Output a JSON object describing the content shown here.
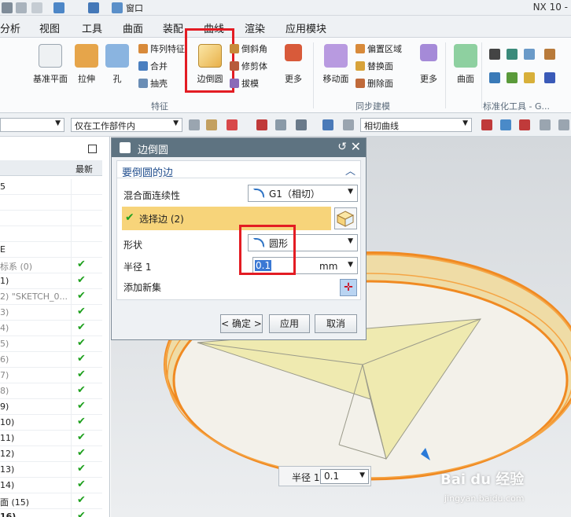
{
  "titlebar": {
    "window_menu": "窗口",
    "app_title": "NX 10 -"
  },
  "menu": {
    "items": [
      "分析",
      "视图",
      "工具",
      "曲面",
      "装配",
      "曲线",
      "渲染",
      "应用模块"
    ]
  },
  "ribbon": {
    "big": [
      {
        "label": "基准平面"
      },
      {
        "label": "拉伸"
      },
      {
        "label": "孔"
      },
      {
        "label": "边倒圆"
      },
      {
        "label": "更多"
      },
      {
        "label": "移动面"
      },
      {
        "label": "更多"
      },
      {
        "label": "曲面"
      }
    ],
    "small": {
      "pattern": "阵列特征",
      "unite": "合并",
      "shell": "抽壳",
      "chamfer": "倒斜角",
      "trim_body": "修剪体",
      "draft": "拔模",
      "offset_region": "偏置区域",
      "replace_face": "替换面",
      "delete_face": "删除面"
    },
    "groups": {
      "feature": "特征",
      "sync": "同步建模",
      "std": "标准化工具 - G..."
    }
  },
  "filterbar": {
    "scope": "仅在工作部件内",
    "curve_rule": "相切曲线"
  },
  "navigator": {
    "col_latest": "最新",
    "rows": [
      {
        "label": "5",
        "check": false,
        "style": ""
      },
      {
        "label": "",
        "check": false,
        "style": ""
      },
      {
        "label": "",
        "check": false,
        "style": ""
      },
      {
        "label": "",
        "check": false,
        "style": ""
      },
      {
        "label": "E",
        "check": false,
        "style": ""
      },
      {
        "label": "标系 (0)",
        "check": true,
        "style": "dim"
      },
      {
        "label": "1)",
        "check": true,
        "style": ""
      },
      {
        "label": "2) \"SKETCH_0...",
        "check": true,
        "style": "dim"
      },
      {
        "label": "3)",
        "check": true,
        "style": "dim"
      },
      {
        "label": "4)",
        "check": true,
        "style": "dim"
      },
      {
        "label": "5)",
        "check": true,
        "style": "dim"
      },
      {
        "label": "6)",
        "check": true,
        "style": "dim"
      },
      {
        "label": "7)",
        "check": true,
        "style": "dim"
      },
      {
        "label": "8)",
        "check": true,
        "style": "dim"
      },
      {
        "label": "9)",
        "check": true,
        "style": ""
      },
      {
        "label": "10)",
        "check": true,
        "style": ""
      },
      {
        "label": "11)",
        "check": true,
        "style": ""
      },
      {
        "label": "12)",
        "check": true,
        "style": ""
      },
      {
        "label": "13)",
        "check": true,
        "style": ""
      },
      {
        "label": "14)",
        "check": true,
        "style": ""
      },
      {
        "label": "面 (15)",
        "check": true,
        "style": ""
      },
      {
        "label": "16)",
        "check": true,
        "style": "bold"
      }
    ]
  },
  "dialog": {
    "title": "边倒圆",
    "section": "要倒圆的边",
    "continuity_label": "混合面连续性",
    "continuity_value": "G1（相切）",
    "select_edge": "选择边 (2)",
    "shape_label": "形状",
    "shape_value": "圆形",
    "radius_label": "半径 1",
    "radius_value": "0.1",
    "radius_unit": "mm",
    "add_set": "添加新集",
    "ok": "< 确定 >",
    "apply": "应用",
    "cancel": "取消"
  },
  "viewport_label": {
    "label": "半径 1",
    "value": "0.1"
  },
  "watermark": {
    "brand": "Bai du 经验",
    "url": "jingyan.baidu.com"
  }
}
